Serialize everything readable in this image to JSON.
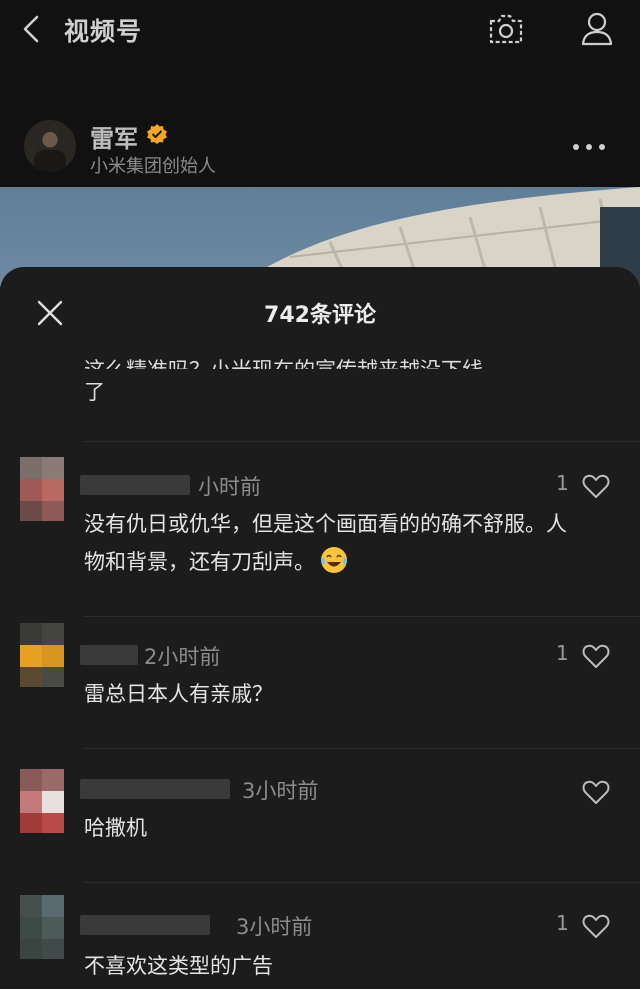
{
  "header": {
    "title": "视频号",
    "back_icon": "chevron-left-icon",
    "camera_icon": "camera-icon",
    "profile_icon": "person-icon"
  },
  "author": {
    "name": "雷军",
    "subtitle": "小米集团创始人",
    "verified_color": "#f5a623",
    "more_icon": "more-dots-icon"
  },
  "comments_sheet": {
    "title": "742条评论",
    "partial_prev": {
      "line1_cut": "这么精准吗？小米现在的宣传越来越没下线",
      "line2": "了"
    },
    "comments": [
      {
        "time": "小时前",
        "text": "没有仇日或仇华，但是这个画面看的的确不舒服。人物和背景，还有刀刮声。",
        "emoji": "tears-of-joy-emoji",
        "likes": "1"
      },
      {
        "time": "2小时前",
        "text": "雷总日本人有亲戚？",
        "likes": "1"
      },
      {
        "time": "3小时前",
        "text": "哈撒机",
        "likes": ""
      },
      {
        "time": "3小时前",
        "text": "不喜欢这类型的广告",
        "likes": "1"
      }
    ]
  },
  "colors": {
    "background": "#111111",
    "sheet": "#1c1c1c",
    "text": "#e4e4e4",
    "muted": "#8c8c8c"
  }
}
